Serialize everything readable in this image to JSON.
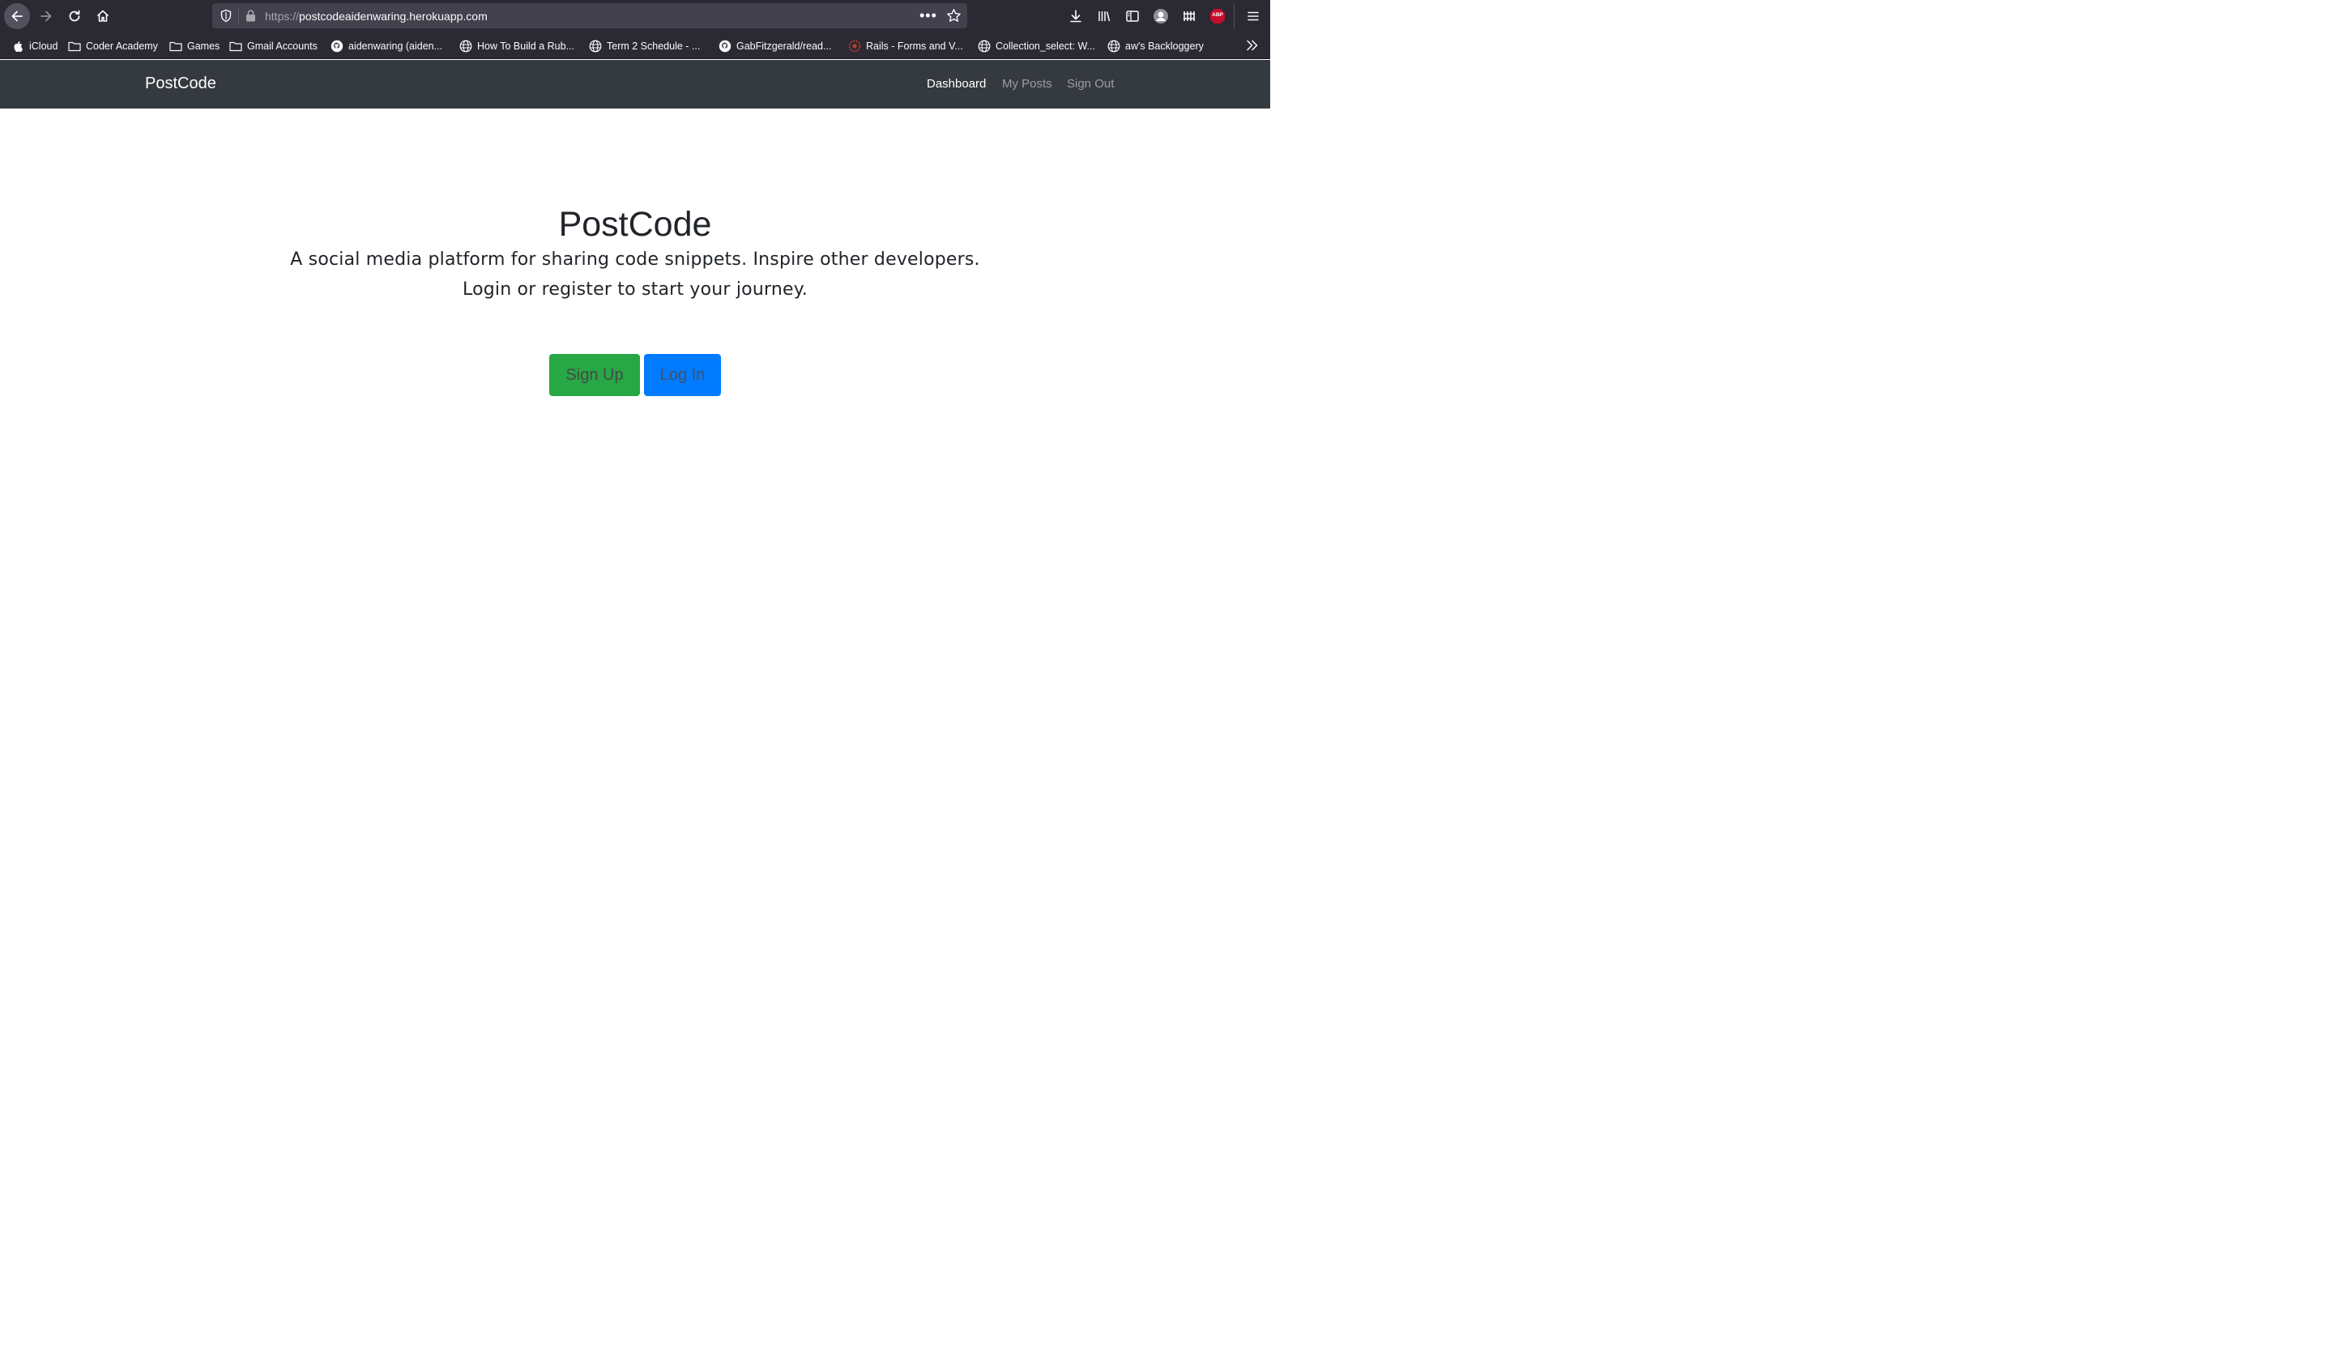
{
  "browser": {
    "url_scheme": "https://",
    "url_host": "postcodeaidenwaring.herokuapp.com",
    "bookmarks": [
      {
        "label": "iCloud",
        "icon": "apple-icon"
      },
      {
        "label": "Coder Academy",
        "icon": "folder-icon"
      },
      {
        "label": "Games",
        "icon": "folder-icon"
      },
      {
        "label": "Gmail Accounts",
        "icon": "folder-icon"
      },
      {
        "label": "aidenwaring (aiden...",
        "icon": "github-icon"
      },
      {
        "label": "How To Build a Rub...",
        "icon": "globe-icon"
      },
      {
        "label": "Term 2 Schedule - ...",
        "icon": "globe-icon"
      },
      {
        "label": "GabFitzgerald/read...",
        "icon": "github-icon"
      },
      {
        "label": "Rails - Forms and V...",
        "icon": "rails-icon"
      },
      {
        "label": "Collection_select: W...",
        "icon": "globe-icon"
      },
      {
        "label": "aw's Backloggery",
        "icon": "globe-icon"
      }
    ],
    "abp_badge": "ABP",
    "colors": {
      "chrome": "#2b2a33",
      "urlbar": "#42414d"
    }
  },
  "navbar": {
    "brand": "PostCode",
    "links": [
      {
        "label": "Dashboard",
        "active": true
      },
      {
        "label": "My Posts",
        "active": false
      },
      {
        "label": "Sign Out",
        "active": false
      }
    ],
    "background": "#343a40"
  },
  "hero": {
    "title": "PostCode",
    "line1": "A social media platform for sharing code snippets. Inspire other developers.",
    "line2": "Login or register to start your journey.",
    "signup_label": "Sign Up",
    "login_label": "Log In",
    "colors": {
      "signup": "#28a745",
      "login": "#007bff"
    }
  }
}
